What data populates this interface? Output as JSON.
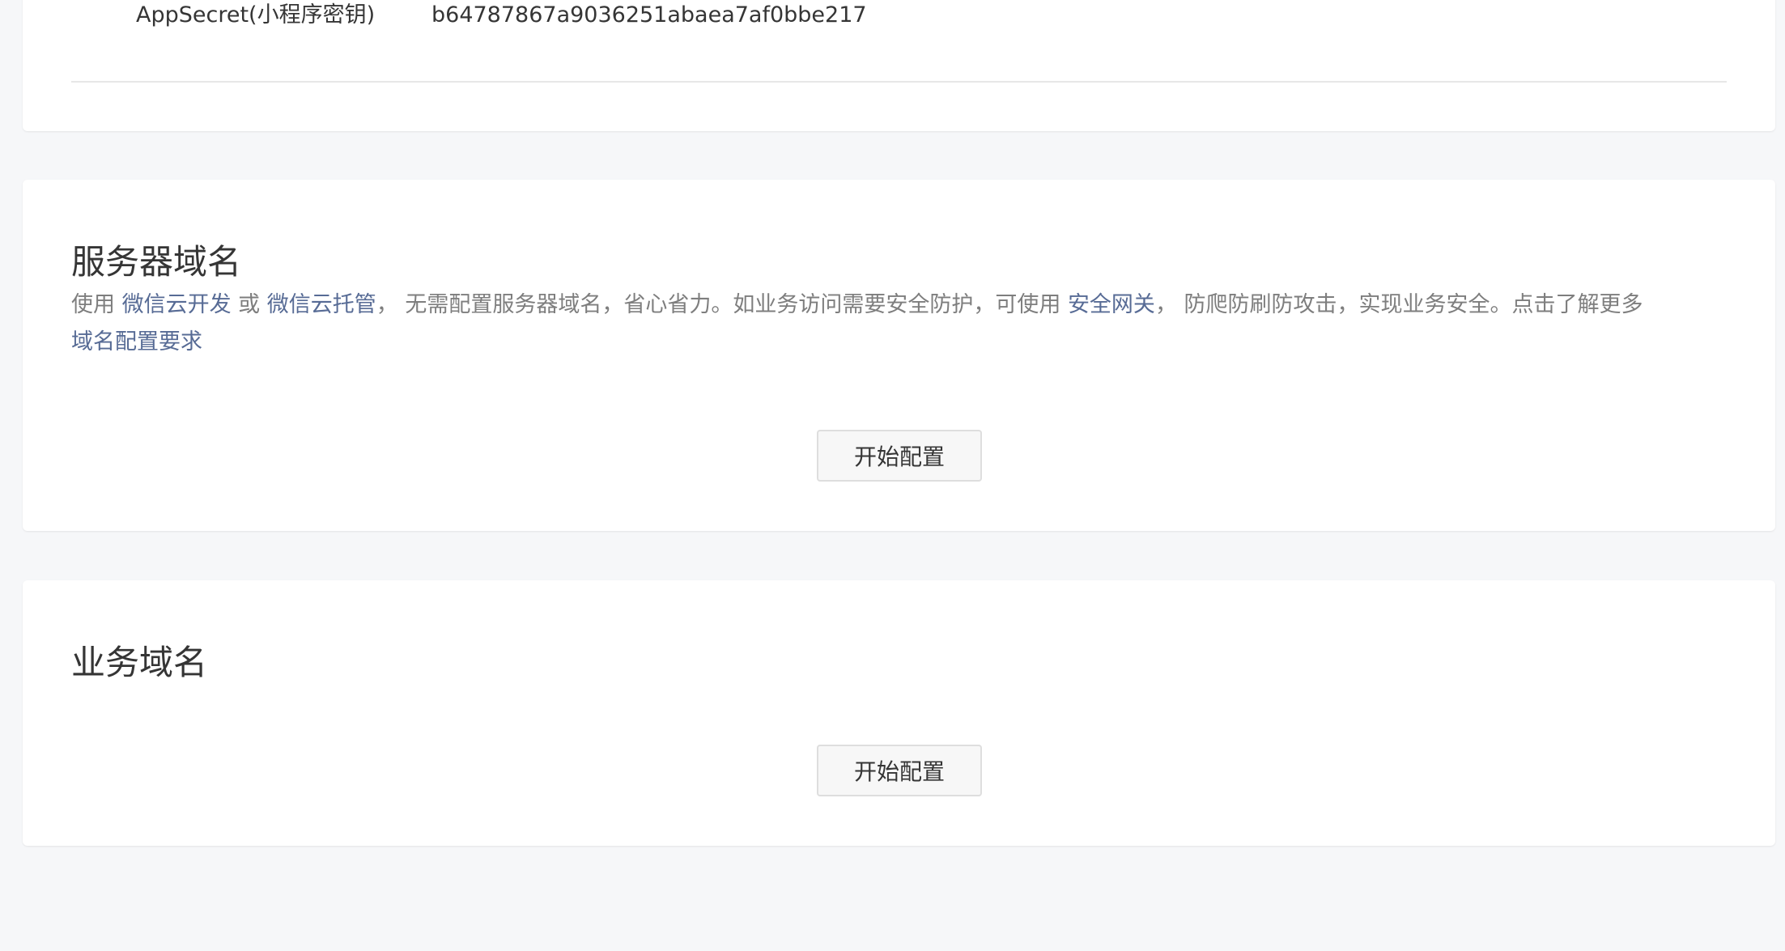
{
  "app_info": {
    "appsecret_label": "AppSecret(小程序密钥)",
    "appsecret_value": "b64787867a9036251abaea7af0bbe217"
  },
  "server_domain": {
    "title": "服务器域名",
    "desc_prefix": "使用 ",
    "link_cloud_dev": "微信云开发",
    "desc_or": " 或 ",
    "link_cloud_hosting": "微信云托管",
    "desc_middle": "， 无需配置服务器域名，省心省力。如业务访问需要安全防护，可使用 ",
    "link_security_gateway": "安全网关",
    "desc_after_gateway": "， 防爬防刷防攻击，实现业务安全。点击了解更多",
    "link_domain_requirements": "域名配置要求",
    "button_label": "开始配置"
  },
  "business_domain": {
    "title": "业务域名",
    "button_label": "开始配置"
  }
}
